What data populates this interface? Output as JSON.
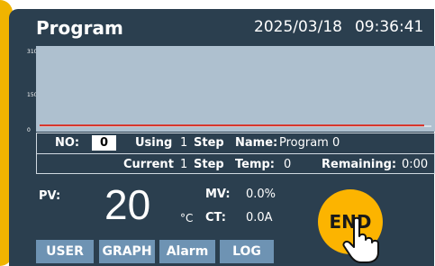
{
  "header": {
    "title": "Program",
    "date": "2025/03/18",
    "time": "09:36:41"
  },
  "chart_data": {
    "type": "line",
    "yticks": [
      "310",
      "150",
      "0"
    ],
    "ylim": [
      0,
      310
    ],
    "series": [
      {
        "color": "#d93025",
        "x": [
          0,
          1
        ],
        "y": [
          3,
          3
        ]
      }
    ]
  },
  "program_info": {
    "no_label": "NO:",
    "no_value": "0",
    "using_label": "Using",
    "using_value": "1",
    "using_unit": "Step",
    "name_label": "Name:",
    "name_value": "Program 0",
    "current_label": "Current",
    "current_value": "1",
    "current_unit": "Step",
    "temp_label": "Temp:",
    "temp_value": "0",
    "remaining_label": "Remaining:",
    "remaining_value": "0:00"
  },
  "readout": {
    "pv_label": "PV:",
    "pv_value": "20",
    "pv_unit": "°C",
    "mv_label": "MV:",
    "mv_value": "0.0%",
    "ct_label": "CT:",
    "ct_value": "0.0A"
  },
  "end_button": {
    "label": "END"
  },
  "nav": [
    "USER",
    "GRAPH",
    "Alarm",
    "LOG"
  ],
  "colors": {
    "accent": "#f0b400",
    "panel": "#2b3f4f",
    "chart_bg": "#aec0cf",
    "nav_button": "#6e93b3",
    "end_button": "#fcb400"
  }
}
